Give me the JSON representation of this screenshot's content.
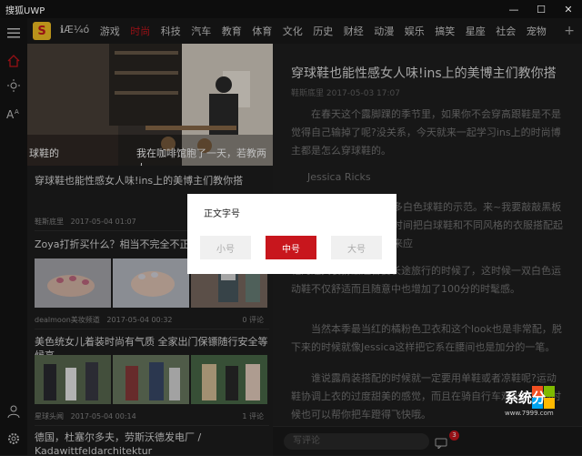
{
  "window": {
    "title": "搜狐UWP",
    "minimize": "—",
    "maximize": "☐",
    "close": "✕"
  },
  "nav": {
    "logo_text": "S",
    "items": [
      "ℹÆ¼ó",
      "游戏",
      "时尚",
      "科技",
      "汽车",
      "教育",
      "体育",
      "文化",
      "历史",
      "财经",
      "动漫",
      "娱乐",
      "搞笑",
      "星座",
      "社会",
      "宠物"
    ],
    "active_index": 2,
    "plus": "+"
  },
  "sidebar": {
    "icons": [
      "menu-icon",
      "home-icon",
      "brightness-icon",
      "font-size-icon",
      "user-icon",
      "settings-icon"
    ]
  },
  "hero": {
    "caption_left": "球鞋的",
    "caption_right": "我在咖啡馆胞了一天，若教两人"
  },
  "news": [
    {
      "title": "穿球鞋也能性感女人味!ins上的美博主们教你搭",
      "source": "鞋斯底里",
      "date": "2017-05-04 01:07",
      "comments": ""
    },
    {
      "title": "Zoya打折买什么？相当不完全不正统",
      "source": "dealmoon美妆频道",
      "date": "2017-05-04 00:32",
      "comments": "0 评论"
    },
    {
      "title": "美色统女儿着装时尚有气质 全家出门保镖随行安全等候高",
      "source": "星球头闻",
      "date": "2017-05-04 00:14",
      "comments": "1 评论"
    },
    {
      "title": "德国，杜塞尔多夫，劳斯沃德发电厂 / Kadawittfeldarchitektur",
      "source": "",
      "date": "",
      "comments": ""
    }
  ],
  "article": {
    "title": "穿球鞋也能性感女人味!ins上的美博主们教你搭",
    "meta": "鞋斯底里 2017-05-03 17:07",
    "paragraphs": [
      "在春天这个露脚踝的季节里，如果你不会穿高跟鞋是不是觉得自己输掉了呢?没关系，今天就来一起学习ins上的时尚博主都是怎么穿球鞋的。",
      "Jessica Ricks",
      "多白色球鞋的示范。来~我要敲敲黑板时间把白球鞋和不同风格的衣服搭配起来应",
      "鞋的经典装扮最适合要长途旅行的时候了，这时候一双白色运动鞋不仅舒适而且随意中也增加了100分的时髦感。",
      "当然本季最当红的橘粉色卫衣和这个look也是非常配，脱下来的时候就像Jessica这样把它系在腰间也是加分的一笔。",
      "谁说露肩装搭配的时候就一定要用单鞋或者凉鞋呢?运动鞋协调上衣的过度甜美的感觉，而且在骑自行车观光游玩的时候也可以帮你把车蹬得飞快哦。"
    ]
  },
  "bottombar": {
    "comment_placeholder": "写评论",
    "badge": "3"
  },
  "dialog": {
    "title": "正文字号",
    "options": [
      "小号",
      "中号",
      "大号"
    ],
    "selected": "中号",
    "accent": "#c8161d"
  },
  "watermark": {
    "text": "系统分",
    "url": "www.7999.com"
  }
}
